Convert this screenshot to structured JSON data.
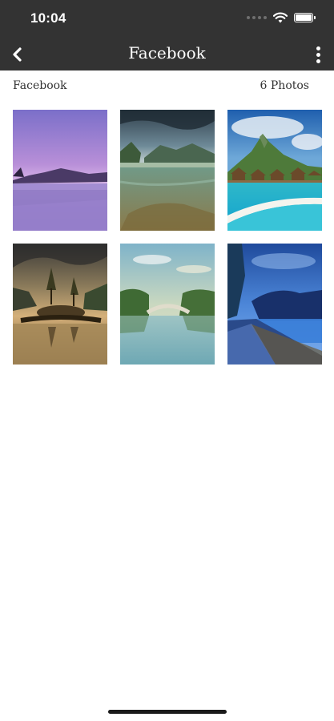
{
  "status_bar": {
    "time": "10:04",
    "icons": [
      "signal-icon",
      "wifi-icon",
      "battery-icon"
    ]
  },
  "nav": {
    "title": "Facebook",
    "back_icon": "chevron-left-icon",
    "menu_icon": "more-vertical-icon"
  },
  "album": {
    "name": "Facebook",
    "count_label": "6 Photos"
  },
  "photos": [
    {
      "subject": "purple lake sunset with mountains"
    },
    {
      "subject": "clear lagoon with stormy sky"
    },
    {
      "subject": "overwater bungalows with turquoise sea"
    },
    {
      "subject": "island with trees at golden sunset"
    },
    {
      "subject": "stone bridge over calm lake"
    },
    {
      "subject": "blue twilight river path"
    }
  ],
  "colors": {
    "bar_background": "#333333",
    "bar_text": "#ffffff",
    "page_background": "#ffffff",
    "body_text": "#333333"
  }
}
